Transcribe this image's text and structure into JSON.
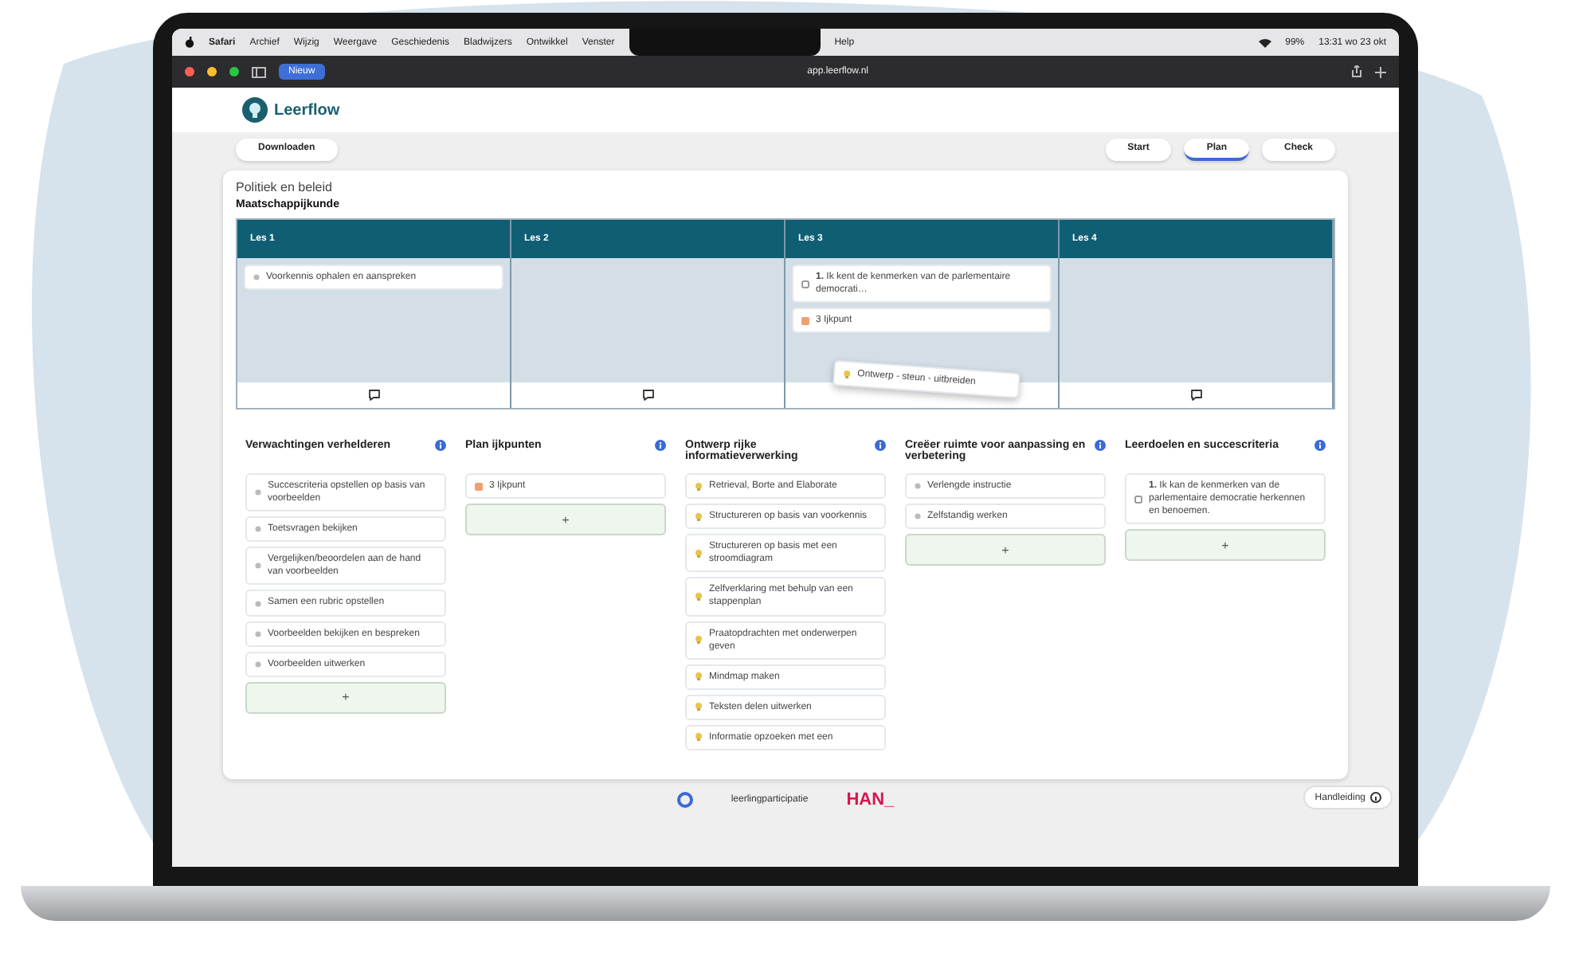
{
  "menu_bar": {
    "items": [
      "Safari",
      "Archief",
      "Wijzig",
      "Weergave",
      "Geschiedenis",
      "Bladwijzers",
      "Ontwikkel",
      "Venster",
      "Help"
    ],
    "battery": "99%",
    "clock": "13:31 wo 23 okt"
  },
  "browser": {
    "tab_group": "Nieuw",
    "url": "app.leerflow.nl"
  },
  "app": {
    "logo": "Leerflow",
    "download": "Downloaden",
    "tabs": [
      {
        "label": "Start",
        "selected": false
      },
      {
        "label": "Plan",
        "selected": true
      },
      {
        "label": "Check",
        "selected": false
      }
    ],
    "title": "Politiek en beleid",
    "subject": "Maatschappijkunde",
    "lessons": [
      {
        "label": "Les 1",
        "cards": [
          {
            "kind": "activity",
            "text": "Voorkennis ophalen en aanspreken"
          }
        ]
      },
      {
        "label": "Les 2"
      },
      {
        "label": "Les 3",
        "cards": [
          {
            "kind": "goal",
            "text": "**1.** Ik kent de kenmerken van de parlementaire democrati…"
          },
          {
            "kind": "checkpoint",
            "text": "3 Ijkpunt"
          }
        ],
        "dragged_card": {
          "kind": "strategy",
          "text": "Ontwerp - steun - uitbreiden"
        }
      },
      {
        "label": "Les 4"
      }
    ],
    "columns": [
      {
        "title": "Verwachtingen verhelderen",
        "add": "+",
        "cards": [
          {
            "kind": "activity",
            "text": "Succescriteria opstellen op basis van voorbeelden"
          },
          {
            "kind": "activity",
            "text": "Toetsvragen bekijken"
          },
          {
            "kind": "activity",
            "text": "Vergelijken/beoordelen aan de hand van voorbeelden"
          },
          {
            "kind": "activity",
            "text": "Samen een rubric opstellen"
          },
          {
            "kind": "activity",
            "text": "Voorbeelden bekijken en bespreken"
          },
          {
            "kind": "activity",
            "text": "Voorbeelden uitwerken"
          }
        ]
      },
      {
        "title": "Plan ijkpunten",
        "add": "+",
        "cards": [
          {
            "kind": "checkpoint",
            "text": "3 Ijkpunt"
          }
        ]
      },
      {
        "title": "Ontwerp rijke informatieverwerking",
        "cards": [
          {
            "kind": "strategy",
            "text": "Retrieval, Borte and Elaborate"
          },
          {
            "kind": "strategy",
            "text": "Structureren op basis van voorkennis"
          },
          {
            "kind": "strategy",
            "text": "Structureren op basis met een stroomdiagram"
          },
          {
            "kind": "strategy",
            "text": "Zelfverklaring met behulp van een stappenplan"
          },
          {
            "kind": "strategy",
            "text": "Praatopdrachten met onderwerpen geven"
          },
          {
            "kind": "strategy",
            "text": "Mindmap maken"
          },
          {
            "kind": "strategy",
            "text": "Teksten delen uitwerken"
          },
          {
            "kind": "strategy",
            "text": "Informatie opzoeken met een"
          }
        ]
      },
      {
        "title": "Creëer ruimte voor aanpassing en verbetering",
        "add": "+",
        "cards": [
          {
            "kind": "activity",
            "text": "Verlengde instructie"
          },
          {
            "kind": "activity",
            "text": "Zelfstandig werken"
          }
        ]
      },
      {
        "title": "Leerdoelen en succescriteria",
        "add": "+",
        "cards": [
          {
            "kind": "goal",
            "text": "**1.** Ik kan de kenmerken van de parlementaire democratie herkennen en benoemen."
          }
        ]
      }
    ]
  },
  "footer": {
    "partner": "leerlingparticipatie",
    "han": "HAN_",
    "help": "Handleiding"
  }
}
